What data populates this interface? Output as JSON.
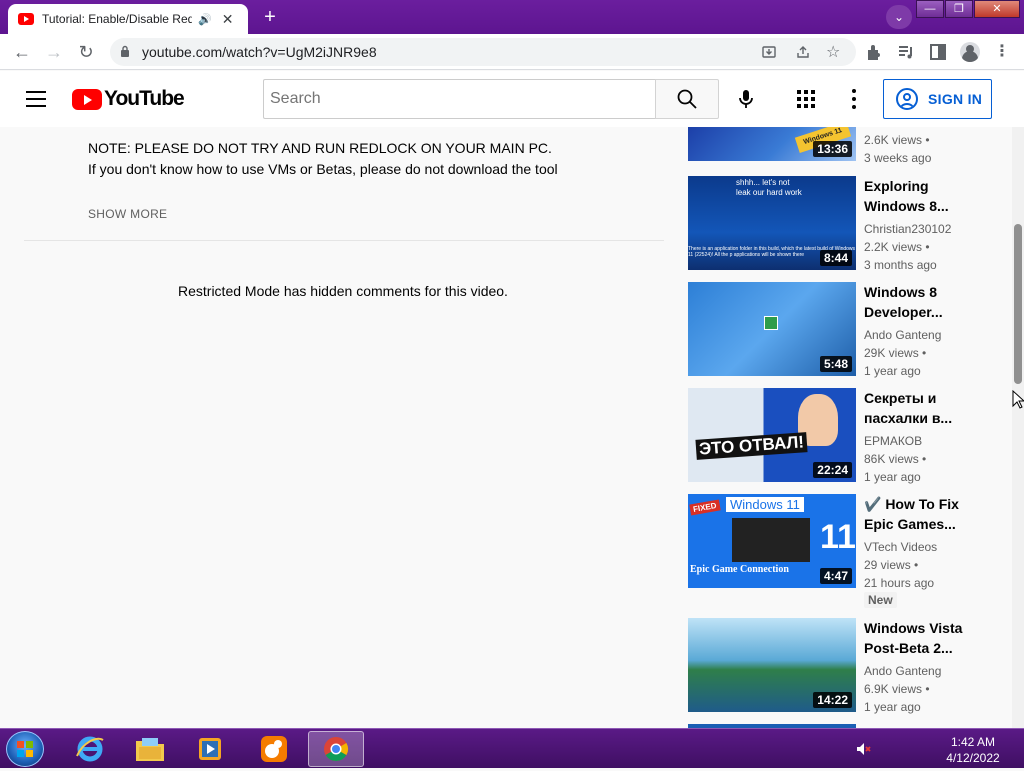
{
  "browser": {
    "tab_title": "Tutorial: Enable/Disable Redlock",
    "url": "youtube.com/watch?v=UgM2iJNR9e8"
  },
  "masthead": {
    "logo_text": "YouTube",
    "search_placeholder": "Search",
    "signin_label": "SIGN IN"
  },
  "description": {
    "line1": "NOTE: PLEASE DO NOT TRY AND RUN REDLOCK ON YOUR MAIN PC.",
    "line2": "If you don't know how to use VMs or Betas, please do not download the tool",
    "show_more": "SHOW MORE"
  },
  "comments": {
    "restricted_message": "Restricted Mode has hidden comments for this video."
  },
  "recommendations": [
    {
      "title": "",
      "channel": "",
      "views": "2.6K views •",
      "age": "3 weeks ago",
      "duration": "13:36"
    },
    {
      "title": "Exploring Windows 8...",
      "channel": "Christian230102",
      "views": "2.2K views •",
      "age": "3 months ago",
      "duration": "8:44"
    },
    {
      "title": "Windows 8 Developer...",
      "channel": "Ando Ganteng",
      "views": "29K views •",
      "age": "1 year ago",
      "duration": "5:48"
    },
    {
      "title": "Секреты и пасхалки в...",
      "channel": "ЕРМАКОВ",
      "views": "86K views •",
      "age": "1 year ago",
      "duration": "22:24"
    },
    {
      "title": "✔️ How To Fix Epic Games...",
      "channel": "VTech Videos",
      "views": "29 views •",
      "age": "21 hours ago",
      "duration": "4:47",
      "badge": "New"
    },
    {
      "title": "Windows Vista Post-Beta 2...",
      "channel": "Ando Ganteng",
      "views": "6.9K views •",
      "age": "1 year ago",
      "duration": "14:22"
    }
  ],
  "thumb_text": {
    "rec1_badge": "Windows 11",
    "rec2_top": "shhh... let's not leak our hard work",
    "rec2_bottom": "There is an application folder in this build, which the latest build of Windows 11 (22524)! All the p applications will be shown there",
    "rec4_caption": "ЭТО ОТВАЛ!",
    "rec5_fixed": "FIXED",
    "rec5_title": "Windows 11",
    "rec5_eleven": "11",
    "rec5_footer": "Epic Game Connection"
  },
  "taskbar": {
    "time": "1:42 AM",
    "date": "4/12/2022"
  },
  "colors": {
    "youtube_red": "#ff0000",
    "signin_blue": "#065fd4",
    "browser_frame": "#6a1b9a"
  }
}
